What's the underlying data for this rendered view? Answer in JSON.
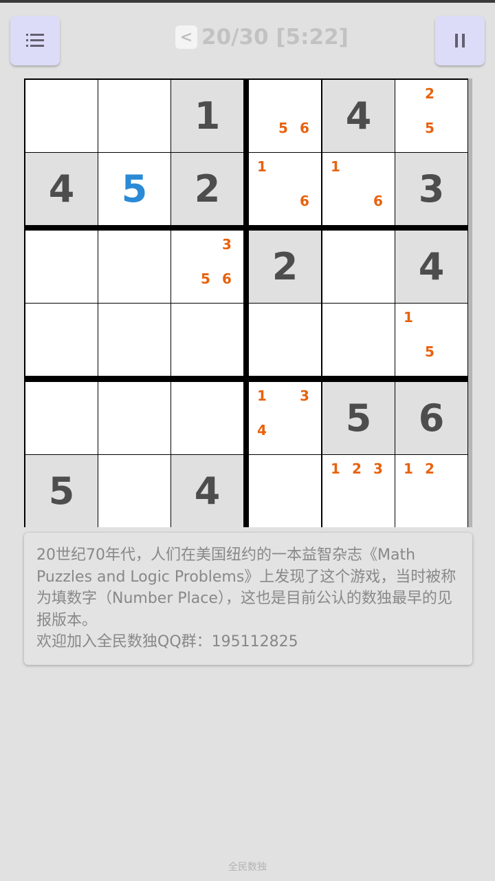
{
  "header": {
    "back_symbol": "<",
    "progress_text": "20/30 [5:22]"
  },
  "buttons": {
    "menu_icon": "menu-icon",
    "pause_icon": "pause-icon"
  },
  "colors": {
    "given": "#4d4d4d",
    "entered": "#2b8ad6",
    "note": "#e8620e",
    "shaded_cell": "#e0e0e0",
    "blank_cell": "#ffffff",
    "button_bg": "#dcdcf9"
  },
  "board": {
    "rows": 6,
    "cols": 6,
    "visible_rows": 6,
    "cells": [
      [
        {
          "v": "",
          "shade": false
        },
        {
          "v": "",
          "shade": false
        },
        {
          "v": "1",
          "given": true,
          "shade": true
        },
        {
          "v": "",
          "shade": false,
          "notes": [
            "5",
            "6"
          ]
        },
        {
          "v": "4",
          "given": true,
          "shade": true
        },
        {
          "v": "",
          "shade": false,
          "notes": [
            "2",
            "5"
          ]
        }
      ],
      [
        {
          "v": "4",
          "given": true,
          "shade": true
        },
        {
          "v": "5",
          "given": false,
          "shade": false
        },
        {
          "v": "2",
          "given": true,
          "shade": true
        },
        {
          "v": "",
          "shade": false,
          "notes": [
            "1",
            "6"
          ]
        },
        {
          "v": "",
          "shade": false,
          "notes": [
            "1",
            "6"
          ]
        },
        {
          "v": "3",
          "given": true,
          "shade": true
        }
      ],
      [
        {
          "v": "",
          "shade": false
        },
        {
          "v": "",
          "shade": false
        },
        {
          "v": "",
          "shade": false,
          "notes": [
            "3",
            "5",
            "6"
          ]
        },
        {
          "v": "2",
          "given": true,
          "shade": true
        },
        {
          "v": "",
          "shade": false
        },
        {
          "v": "4",
          "given": true,
          "shade": true
        }
      ],
      [
        {
          "v": "",
          "shade": false
        },
        {
          "v": "",
          "shade": false
        },
        {
          "v": "",
          "shade": false
        },
        {
          "v": "",
          "shade": false
        },
        {
          "v": "",
          "shade": false
        },
        {
          "v": "",
          "shade": false,
          "notes": [
            "1",
            "5"
          ]
        }
      ],
      [
        {
          "v": "",
          "shade": false
        },
        {
          "v": "",
          "shade": false
        },
        {
          "v": "",
          "shade": false
        },
        {
          "v": "",
          "shade": false,
          "notes": [
            "1",
            "3",
            "4"
          ]
        },
        {
          "v": "5",
          "given": true,
          "shade": true
        },
        {
          "v": "6",
          "given": true,
          "shade": true
        }
      ],
      [
        {
          "v": "5",
          "given": true,
          "shade": true
        },
        {
          "v": "",
          "shade": false
        },
        {
          "v": "4",
          "given": true,
          "shade": true
        },
        {
          "v": "",
          "shade": false
        },
        {
          "v": "",
          "shade": false,
          "notes": [
            "1",
            "2",
            "3"
          ]
        },
        {
          "v": "",
          "shade": false,
          "notes": [
            "1",
            "2"
          ]
        }
      ]
    ]
  },
  "info": {
    "text": "20世纪70年代，人们在美国纽约的一本益智杂志《Math Puzzles and Logic Problems》上发现了这个游戏，当时被称为填数字（Number Place），这也是目前公认的数独最早的见报版本。\n欢迎加入全民数独QQ群：195112825"
  },
  "footer": {
    "label": "全民数独"
  }
}
